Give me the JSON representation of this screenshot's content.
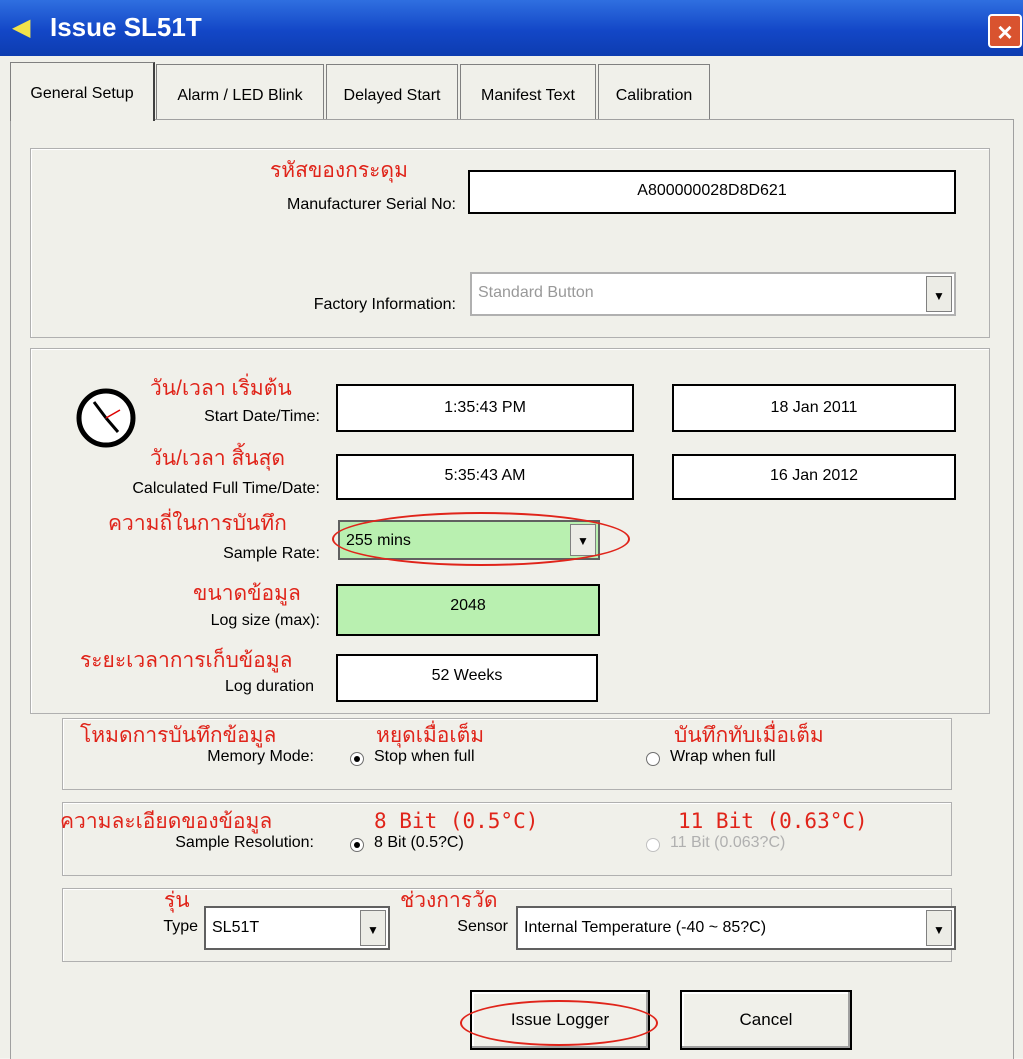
{
  "window": {
    "title": "Issue  SL51T",
    "close_glyph": "×"
  },
  "tabs": [
    "General Setup",
    "Alarm / LED Blink",
    "Delayed Start",
    "Manifest Text",
    "Calibration"
  ],
  "device": {
    "serial_thai": "รหัสของกระดุม",
    "serial_label": "Manufacturer Serial No:",
    "serial_value": "A800000028D8D621",
    "factory_label": "Factory Information:",
    "factory_value": "Standard Button"
  },
  "timing": {
    "start_thai": "วัน/เวลา  เริ่มต้น",
    "start_label": "Start Date/Time:",
    "start_time": "1:35:43 PM",
    "start_date": "18 Jan 2011",
    "end_thai": "วัน/เวลา  สิ้นสุด",
    "end_label": "Calculated Full Time/Date:",
    "end_time": "5:35:43 AM",
    "end_date": "16 Jan 2012",
    "rate_thai": "ความถี่ในการบันทึก",
    "rate_label": "Sample Rate:",
    "rate_value": "255 mins",
    "log_thai": "ขนาดข้อมูล",
    "log_label": "Log size (max):",
    "log_value": "2048",
    "duration_thai": "ระยะเวลาการเก็บข้อมูล",
    "duration_label": "Log duration",
    "duration_value": "52 Weeks"
  },
  "memory": {
    "thai": "โหมดการบันทึกข้อมูล",
    "label": "Memory Mode:",
    "stop_thai": "หยุดเมื่อเต็ม",
    "stop_label": "Stop when full",
    "wrap_thai": "บันทึกทับเมื่อเต็ม",
    "wrap_label": "Wrap when full"
  },
  "resolution": {
    "thai": "ความละเอียดของข้อมูล",
    "label": "Sample Resolution:",
    "opt1_red": "8 Bit (0.5°C)",
    "opt1_label": "8 Bit  (0.5?C)",
    "opt2_red": "11 Bit (0.63°C)",
    "opt2_label": "11 Bit  (0.063?C)"
  },
  "type_sensor": {
    "type_thai": "รุ่น",
    "type_label": "Type",
    "type_value": "SL51T",
    "sensor_thai": "ช่วงการวัด",
    "sensor_label": "Sensor",
    "sensor_value": "Internal Temperature (-40 ~ 85?C)"
  },
  "buttons": {
    "issue": "Issue Logger",
    "cancel": "Cancel"
  },
  "colors": {
    "annotation": "#e0241a",
    "titlebar": "#1347c7",
    "highlight": "#b9f0b0"
  },
  "icons": {
    "title": "arrow-icon",
    "clock": "clock-icon",
    "dropdown": "chevron-down-icon"
  }
}
